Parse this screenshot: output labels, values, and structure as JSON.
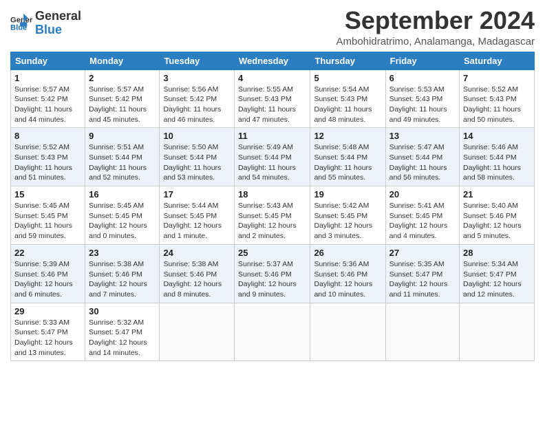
{
  "header": {
    "logo_line1": "General",
    "logo_line2": "Blue",
    "month_title": "September 2024",
    "location": "Ambohidratrimo, Analamanga, Madagascar"
  },
  "weekdays": [
    "Sunday",
    "Monday",
    "Tuesday",
    "Wednesday",
    "Thursday",
    "Friday",
    "Saturday"
  ],
  "weeks": [
    [
      {
        "day": "1",
        "info": "Sunrise: 5:57 AM\nSunset: 5:42 PM\nDaylight: 11 hours\nand 44 minutes."
      },
      {
        "day": "2",
        "info": "Sunrise: 5:57 AM\nSunset: 5:42 PM\nDaylight: 11 hours\nand 45 minutes."
      },
      {
        "day": "3",
        "info": "Sunrise: 5:56 AM\nSunset: 5:42 PM\nDaylight: 11 hours\nand 46 minutes."
      },
      {
        "day": "4",
        "info": "Sunrise: 5:55 AM\nSunset: 5:43 PM\nDaylight: 11 hours\nand 47 minutes."
      },
      {
        "day": "5",
        "info": "Sunrise: 5:54 AM\nSunset: 5:43 PM\nDaylight: 11 hours\nand 48 minutes."
      },
      {
        "day": "6",
        "info": "Sunrise: 5:53 AM\nSunset: 5:43 PM\nDaylight: 11 hours\nand 49 minutes."
      },
      {
        "day": "7",
        "info": "Sunrise: 5:52 AM\nSunset: 5:43 PM\nDaylight: 11 hours\nand 50 minutes."
      }
    ],
    [
      {
        "day": "8",
        "info": "Sunrise: 5:52 AM\nSunset: 5:43 PM\nDaylight: 11 hours\nand 51 minutes."
      },
      {
        "day": "9",
        "info": "Sunrise: 5:51 AM\nSunset: 5:44 PM\nDaylight: 11 hours\nand 52 minutes."
      },
      {
        "day": "10",
        "info": "Sunrise: 5:50 AM\nSunset: 5:44 PM\nDaylight: 11 hours\nand 53 minutes."
      },
      {
        "day": "11",
        "info": "Sunrise: 5:49 AM\nSunset: 5:44 PM\nDaylight: 11 hours\nand 54 minutes."
      },
      {
        "day": "12",
        "info": "Sunrise: 5:48 AM\nSunset: 5:44 PM\nDaylight: 11 hours\nand 55 minutes."
      },
      {
        "day": "13",
        "info": "Sunrise: 5:47 AM\nSunset: 5:44 PM\nDaylight: 11 hours\nand 56 minutes."
      },
      {
        "day": "14",
        "info": "Sunrise: 5:46 AM\nSunset: 5:44 PM\nDaylight: 11 hours\nand 58 minutes."
      }
    ],
    [
      {
        "day": "15",
        "info": "Sunrise: 5:45 AM\nSunset: 5:45 PM\nDaylight: 11 hours\nand 59 minutes."
      },
      {
        "day": "16",
        "info": "Sunrise: 5:45 AM\nSunset: 5:45 PM\nDaylight: 12 hours\nand 0 minutes."
      },
      {
        "day": "17",
        "info": "Sunrise: 5:44 AM\nSunset: 5:45 PM\nDaylight: 12 hours\nand 1 minute."
      },
      {
        "day": "18",
        "info": "Sunrise: 5:43 AM\nSunset: 5:45 PM\nDaylight: 12 hours\nand 2 minutes."
      },
      {
        "day": "19",
        "info": "Sunrise: 5:42 AM\nSunset: 5:45 PM\nDaylight: 12 hours\nand 3 minutes."
      },
      {
        "day": "20",
        "info": "Sunrise: 5:41 AM\nSunset: 5:45 PM\nDaylight: 12 hours\nand 4 minutes."
      },
      {
        "day": "21",
        "info": "Sunrise: 5:40 AM\nSunset: 5:46 PM\nDaylight: 12 hours\nand 5 minutes."
      }
    ],
    [
      {
        "day": "22",
        "info": "Sunrise: 5:39 AM\nSunset: 5:46 PM\nDaylight: 12 hours\nand 6 minutes."
      },
      {
        "day": "23",
        "info": "Sunrise: 5:38 AM\nSunset: 5:46 PM\nDaylight: 12 hours\nand 7 minutes."
      },
      {
        "day": "24",
        "info": "Sunrise: 5:38 AM\nSunset: 5:46 PM\nDaylight: 12 hours\nand 8 minutes."
      },
      {
        "day": "25",
        "info": "Sunrise: 5:37 AM\nSunset: 5:46 PM\nDaylight: 12 hours\nand 9 minutes."
      },
      {
        "day": "26",
        "info": "Sunrise: 5:36 AM\nSunset: 5:46 PM\nDaylight: 12 hours\nand 10 minutes."
      },
      {
        "day": "27",
        "info": "Sunrise: 5:35 AM\nSunset: 5:47 PM\nDaylight: 12 hours\nand 11 minutes."
      },
      {
        "day": "28",
        "info": "Sunrise: 5:34 AM\nSunset: 5:47 PM\nDaylight: 12 hours\nand 12 minutes."
      }
    ],
    [
      {
        "day": "29",
        "info": "Sunrise: 5:33 AM\nSunset: 5:47 PM\nDaylight: 12 hours\nand 13 minutes."
      },
      {
        "day": "30",
        "info": "Sunrise: 5:32 AM\nSunset: 5:47 PM\nDaylight: 12 hours\nand 14 minutes."
      },
      {
        "day": "",
        "info": ""
      },
      {
        "day": "",
        "info": ""
      },
      {
        "day": "",
        "info": ""
      },
      {
        "day": "",
        "info": ""
      },
      {
        "day": "",
        "info": ""
      }
    ]
  ]
}
